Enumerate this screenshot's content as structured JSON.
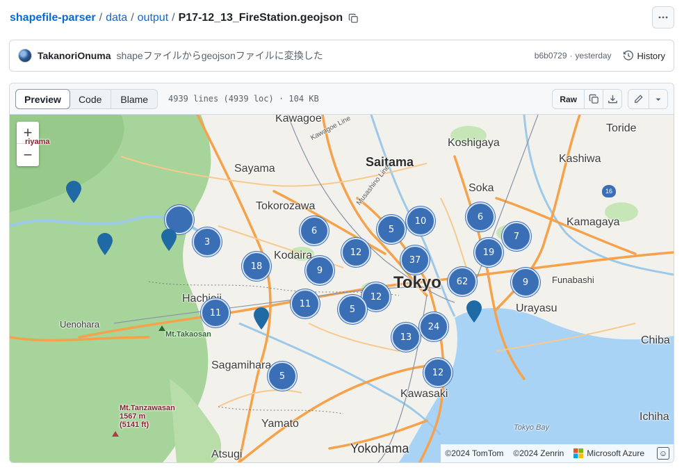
{
  "breadcrumb": {
    "repo": "shapefile-parser",
    "sep": "/",
    "dir1": "data",
    "dir2": "output",
    "file": "P17-12_13_FireStation.geojson"
  },
  "commit": {
    "author": "TakanoriOnuma",
    "message": "shapeファイルからgeojsonファイルに変換した",
    "hash": "b6b0729",
    "dot": "·",
    "when": "yesterday",
    "history_label": "History"
  },
  "file_header": {
    "tabs": [
      "Preview",
      "Code",
      "Blame"
    ],
    "active_tab": "Preview",
    "info": "4939 lines (4939 loc) · 104 KB",
    "raw_label": "Raw"
  },
  "map": {
    "zoom_in": "+",
    "zoom_out": "−",
    "places": {
      "kawagoe": "Kawagoe",
      "kawagoe_line": "Kawagoe Line",
      "musashino_line": "Musashino Line",
      "koshigaya": "Koshigaya",
      "toride": "Toride",
      "kashiwa": "Kashiwa",
      "saitama": "Saitama",
      "sayama": "Sayama",
      "soka": "Soka",
      "tokorozawa": "Tokorozawa",
      "kamagaya": "Kamagaya",
      "kodaira": "Kodaira",
      "tokyo": "Tokyo",
      "funabashi": "Funabashi",
      "hachioji": "Hachioji",
      "urayasu": "Urayasu",
      "uenohara": "Uenohara",
      "mt_takaosan": "Mt.Takaosan",
      "chiba": "Chiba",
      "sagamihara": "Sagamihara",
      "kawasaki": "Kawasaki",
      "tanzawa_name": "Mt.Tanzawasan",
      "tanzawa_m": "1567 m",
      "tanzawa_ft": "(5141 ft)",
      "tokyo_bay": "Tokyo Bay",
      "ichihara": "Ichiha",
      "yamato": "Yamato",
      "atsugi": "Atsugi",
      "yokohama": "Yokohama",
      "riyama": "riyama",
      "road16": "16"
    },
    "clusters": [
      "",
      "3",
      "6",
      "5",
      "10",
      "6",
      "7",
      "12",
      "18",
      "9",
      "37",
      "19",
      "62",
      "9",
      "12",
      "11",
      "11",
      "5",
      "24",
      "13",
      "12",
      "5"
    ],
    "attribution": {
      "tomtom": "©2024 TomTom",
      "zenrin": "©2024 Zenrin",
      "azure": "Microsoft Azure"
    },
    "colors": {
      "forest": "#a6d49a",
      "water": "#a9d3f5",
      "highway": "#f5a24a",
      "cluster": "#3a6fb6"
    }
  }
}
